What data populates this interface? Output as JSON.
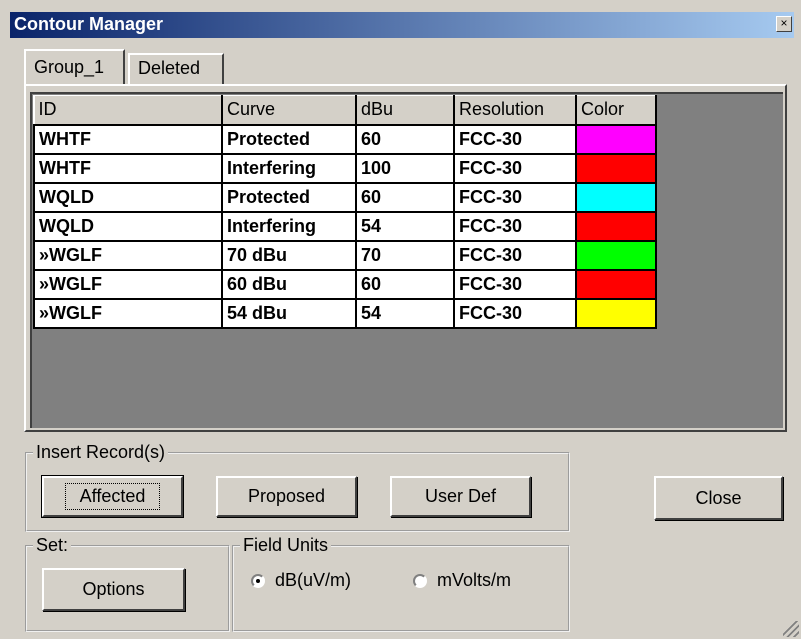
{
  "window": {
    "title": "Contour Manager",
    "close_glyph": "×"
  },
  "tabs": [
    {
      "label": "Group_1",
      "active": true
    },
    {
      "label": "Deleted",
      "active": false
    }
  ],
  "grid": {
    "columns": [
      "ID",
      "Curve",
      "dBu",
      "Resolution",
      "Color"
    ],
    "rows": [
      {
        "id": "WHTF",
        "curve": "Protected",
        "dbu": "60",
        "resolution": "FCC-30",
        "color": "#ff00ff"
      },
      {
        "id": "WHTF",
        "curve": "Interfering",
        "dbu": "100",
        "resolution": "FCC-30",
        "color": "#ff0000"
      },
      {
        "id": "WQLD",
        "curve": "Protected",
        "dbu": "60",
        "resolution": "FCC-30",
        "color": "#00ffff"
      },
      {
        "id": "WQLD",
        "curve": "Interfering",
        "dbu": "54",
        "resolution": "FCC-30",
        "color": "#ff0000"
      },
      {
        "id": "»WGLF",
        "curve": "70 dBu",
        "dbu": "70",
        "resolution": "FCC-30",
        "color": "#00ff00"
      },
      {
        "id": "»WGLF",
        "curve": "60 dBu",
        "dbu": "60",
        "resolution": "FCC-30",
        "color": "#ff0000"
      },
      {
        "id": "»WGLF",
        "curve": "54 dBu",
        "dbu": "54",
        "resolution": "FCC-30",
        "color": "#ffff00"
      }
    ]
  },
  "insert_group": {
    "legend": "Insert Record(s)",
    "affected_label": "Affected",
    "proposed_label": "Proposed",
    "userdef_label": "User Def"
  },
  "set_group": {
    "legend": "Set:",
    "options_label": "Options"
  },
  "field_units": {
    "legend": "Field Units",
    "options": [
      {
        "label": "dB(uV/m)",
        "selected": true
      },
      {
        "label": "mVolts/m",
        "selected": false
      }
    ]
  },
  "close_label": "Close"
}
